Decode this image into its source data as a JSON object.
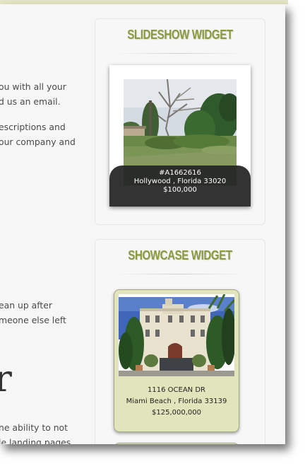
{
  "body_text": {
    "line1": "ou with all your",
    "line2_link": "d us an email",
    "line2_end": ".",
    "line3": "escriptions and",
    "line4": "our company and",
    "line5": "ean up after",
    "line6": "meone else left",
    "big_letter": "r",
    "line7": "ne ability to not",
    "line8": "le landing pages"
  },
  "slideshow": {
    "title": "SLIDESHOW WIDGET",
    "listing": {
      "id": "#A1662616",
      "location": "Hollywood , Florida 33020",
      "price": "$100,000"
    }
  },
  "showcase": {
    "title": "SHOWCASE WIDGET",
    "listing": {
      "address": "1116 OCEAN DR",
      "location": "Miami Beach , Florida 33139",
      "price": "$125,000,000"
    }
  }
}
